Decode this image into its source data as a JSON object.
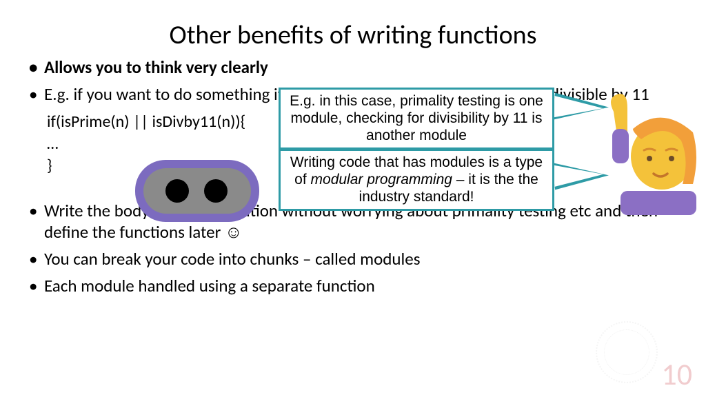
{
  "title": "Other benefits of writing functions",
  "bullets": {
    "b1": "Allows you to think very clearly",
    "b2": "E.g. if you want to do something if a number is a prime number or if it is divisible by 11",
    "b3": "Write the body of the if condition without worrying about primality testing etc and then define the functions later ☺",
    "b4": "You can break your code into chunks – called modules",
    "b5": "Each module handled using a separate function"
  },
  "code": {
    "l1": "if(isPrime(n) || isDivby11(n)){",
    "l2": "   …",
    "l3": "}"
  },
  "callouts": {
    "c1": "E.g. in this case, primality testing is one module, checking for divisibility by 11 is another module",
    "c2_a": "Writing code that has modules is a type of ",
    "c2_b": "modular programming",
    "c2_c": " – it is the the industry standard!"
  },
  "page_number": "10"
}
